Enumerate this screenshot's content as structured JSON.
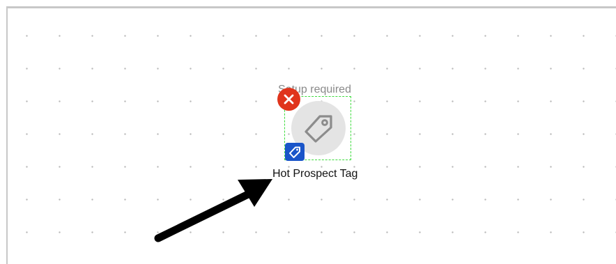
{
  "canvas": {
    "grid": "dotted",
    "background_color": "#ffffff",
    "dot_color": "#b9b9b9"
  },
  "node": {
    "status": "Setup required",
    "label": "Hot Prospect Tag",
    "icon": "tag-icon",
    "badge_icon": "tag-icon",
    "remove_icon": "close-icon",
    "colors": {
      "remove": "#e0341c",
      "badge": "#1a55c9",
      "selection": "#3ddc3d",
      "icon_bg": "#e4e4e4"
    }
  },
  "annotation": {
    "icon": "arrow-icon",
    "color": "#000000"
  }
}
